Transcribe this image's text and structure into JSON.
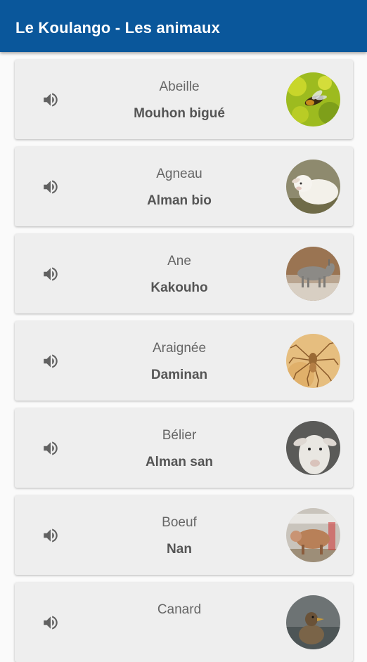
{
  "app": {
    "title": "Le Koulango - Les animaux",
    "bar_color": "#0a579b"
  },
  "animals": [
    {
      "french": "Abeille",
      "koulango": "Mouhon bigué",
      "icon": "bee-photo"
    },
    {
      "french": "Agneau",
      "koulango": "Alman bio",
      "icon": "lamb-photo"
    },
    {
      "french": "Ane",
      "koulango": "Kakouho",
      "icon": "donkey-photo"
    },
    {
      "french": "Araignée",
      "koulango": "Daminan",
      "icon": "spider-photo"
    },
    {
      "french": "Bélier",
      "koulango": "Alman san",
      "icon": "ram-photo"
    },
    {
      "french": "Boeuf",
      "koulango": "Nan",
      "icon": "ox-photo"
    },
    {
      "french": "Canard",
      "koulango": "",
      "icon": "duck-photo"
    }
  ]
}
